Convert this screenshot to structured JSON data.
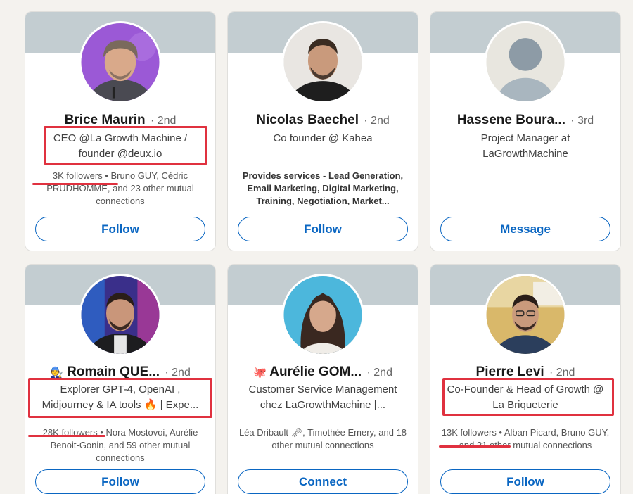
{
  "cards": [
    {
      "name": "Brice Maurin",
      "degree": "· 2nd",
      "headline": "CEO @La Growth Machine / founder @deux.io",
      "insight": "3K followers • Bruno GUY, Cédric PRUDHOMME, and 23 other mutual connections",
      "button": "Follow",
      "avatar_color": "#9b59d6"
    },
    {
      "name": "Nicolas Baechel",
      "degree": "· 2nd",
      "headline": "Co founder @ Kahea",
      "insight": "Provides services - Lead Generation, Email Marketing, Digital Marketing, Training, Negotiation, Market...",
      "button": "Follow",
      "avatar_color": "#e9e6e2"
    },
    {
      "name": "Hassene Boura...",
      "degree": "· 3rd",
      "headline": "Project Manager at LaGrowthMachine",
      "insight": "",
      "button": "Message",
      "avatar_color": "#e8e6df"
    },
    {
      "name_prefix_icon": "🧑‍🔧",
      "name": "Romain QUE...",
      "degree": "· 2nd",
      "headline": "Explorer GPT-4, OpenAI , Midjourney & IA tools 🔥 | Expe...",
      "insight": "28K followers • Nora Mostovoi, Aurélie Benoit-Gonin, and 59 other mutual connections",
      "button": "Follow",
      "avatar_color": "#3a2f8a"
    },
    {
      "name_prefix_icon": "🐙",
      "name": "Aurélie GOM...",
      "degree": "· 2nd",
      "headline": "Customer Service Management chez LaGrowthMachine |...",
      "insight": "Léa Dribault 🗝, Timothée Emery, and 18 other mutual connections",
      "button": "Connect",
      "avatar_color": "#4cb7dc"
    },
    {
      "name": "Pierre Levi",
      "degree": "· 2nd",
      "headline": "Co-Founder & Head of Growth @ La Briqueterie",
      "insight": "13K followers • Alban Picard, Bruno GUY, and 31 other mutual connections",
      "button": "Follow",
      "avatar_color": "#d9b86a"
    }
  ],
  "colors": {
    "accent": "#0a66c2",
    "annotation": "#e0313f"
  }
}
